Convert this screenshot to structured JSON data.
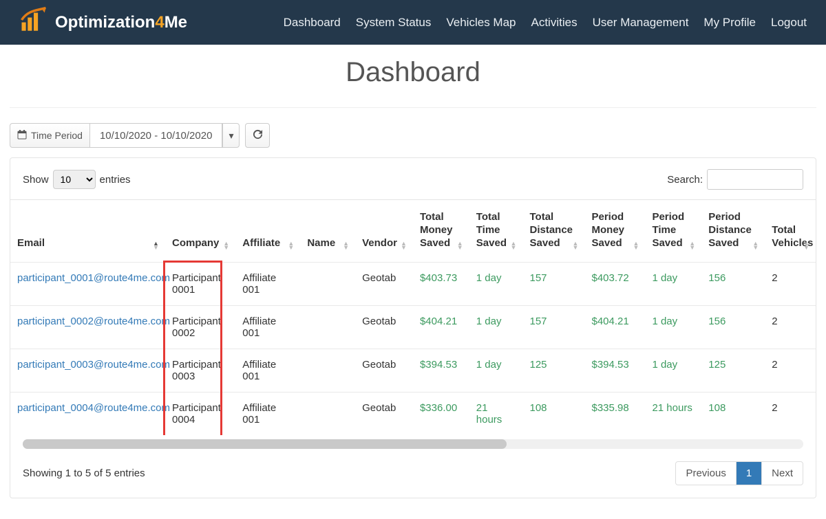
{
  "brand": {
    "text1": "Optimization",
    "four": "4",
    "text2": "Me"
  },
  "nav": {
    "dashboard": "Dashboard",
    "status": "System Status",
    "map": "Vehicles Map",
    "activities": "Activities",
    "users": "User Management",
    "profile": "My Profile",
    "logout": "Logout"
  },
  "page_title": "Dashboard",
  "toolbar": {
    "time_period": "Time Period",
    "date_range": "10/10/2020 - 10/10/2020"
  },
  "length_ctrl": {
    "show": "Show",
    "value": "10",
    "entries": "entries"
  },
  "search_label": "Search:",
  "columns": {
    "email": "Email",
    "company": "Company",
    "affiliate": "Affiliate",
    "name": "Name",
    "vendor": "Vendor",
    "tms": "Total Money Saved",
    "tts": "Total Time Saved",
    "tds": "Total Distance Saved",
    "pms": "Period Money Saved",
    "pts": "Period Time Saved",
    "pds": "Period Distance Saved",
    "vehicles": "Total Vehicles"
  },
  "rows": [
    {
      "email": "participant_0001@route4me.com",
      "company": "Participant 0001",
      "affiliate": "Affiliate 001",
      "name": "",
      "vendor": "Geotab",
      "tms": "$403.73",
      "tts": "1 day",
      "tds": "157",
      "pms": "$403.72",
      "pts": "1 day",
      "pds": "156",
      "vehicles": "2"
    },
    {
      "email": "participant_0002@route4me.com",
      "company": "Participant 0002",
      "affiliate": "Affiliate 001",
      "name": "",
      "vendor": "Geotab",
      "tms": "$404.21",
      "tts": "1 day",
      "tds": "157",
      "pms": "$404.21",
      "pts": "1 day",
      "pds": "156",
      "vehicles": "2"
    },
    {
      "email": "participant_0003@route4me.com",
      "company": "Participant 0003",
      "affiliate": "Affiliate 001",
      "name": "",
      "vendor": "Geotab",
      "tms": "$394.53",
      "tts": "1 day",
      "tds": "125",
      "pms": "$394.53",
      "pts": "1 day",
      "pds": "125",
      "vehicles": "2"
    },
    {
      "email": "participant_0004@route4me.com",
      "company": "Participant 0004",
      "affiliate": "Affiliate 001",
      "name": "",
      "vendor": "Geotab",
      "tms": "$336.00",
      "tts": "21 hours",
      "tds": "108",
      "pms": "$335.98",
      "pts": "21 hours",
      "pds": "108",
      "vehicles": "2"
    }
  ],
  "info": "Showing 1 to 5 of 5 entries",
  "pager": {
    "prev": "Previous",
    "page": "1",
    "next": "Next"
  },
  "scroll_thumb_pct": 62
}
